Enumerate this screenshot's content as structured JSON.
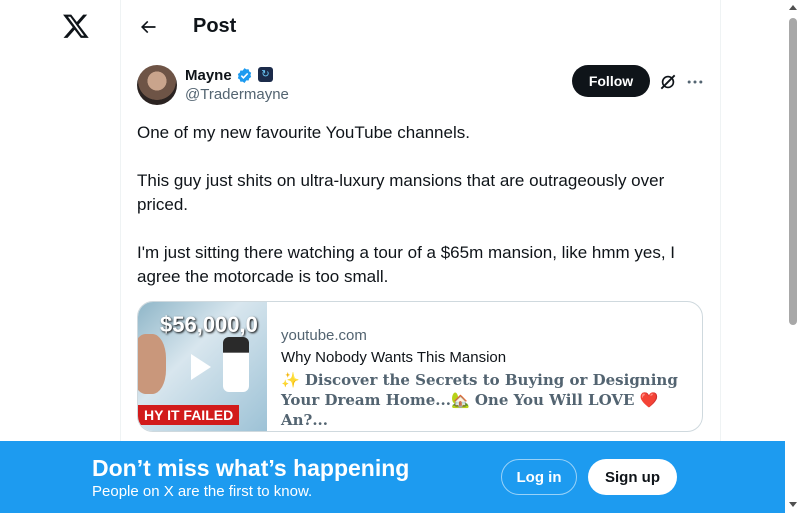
{
  "header": {
    "title": "Post"
  },
  "author": {
    "name": "Mayne",
    "handle": "@Tradermayne",
    "follow_label": "Follow",
    "affiliate_glyph": "↻"
  },
  "tweet": {
    "paragraphs": [
      "One of my new favourite YouTube channels.",
      "This guy just shits on ultra-luxury mansions that are outrageously over priced.",
      "I'm just sitting there watching a tour of a $65m mansion, like hmm yes, I agree the motorcade is too small."
    ]
  },
  "card": {
    "thumb_top_text": "$56,000,0",
    "thumb_bottom_text": "HY IT FAILED",
    "domain": "youtube.com",
    "title": "Why Nobody Wants This Mansion",
    "description": "✨ Discover the Secrets to Buying or Designing Your Dream Home...🏡 One You Will LOVE ❤️ An?..."
  },
  "banner": {
    "title": "Don’t miss what’s happening",
    "subtitle": "People on X are the first to know.",
    "login_label": "Log in",
    "signup_label": "Sign up"
  },
  "colors": {
    "accent": "#1d9bf0",
    "text": "#0f1419",
    "secondary": "#536471"
  },
  "icons": [
    "x-logo-icon",
    "back-arrow-icon",
    "verified-badge-icon",
    "grok-icon",
    "more-icon",
    "play-icon"
  ]
}
